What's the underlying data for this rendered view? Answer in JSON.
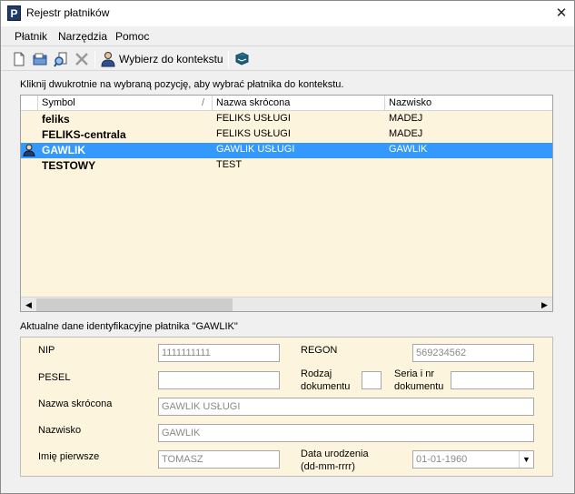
{
  "window": {
    "title": "Rejestr płatników",
    "app_icon_letter": "P",
    "close_glyph": "✕"
  },
  "menu": [
    "Płatnik",
    "Narzędzia",
    "Pomoc"
  ],
  "toolbar": {
    "icons": [
      "new-document-icon",
      "open-folder-icon",
      "find-icon",
      "delete-icon",
      "user-context-icon",
      "book-icon"
    ],
    "select_context_label": "Wybierz do kontekstu"
  },
  "hint": "Kliknij dwukrotnie na wybraną pozycję, aby wybrać płatnika do kontekstu.",
  "grid": {
    "columns": [
      "Symbol",
      "Nazwa skrócona",
      "Nazwisko"
    ],
    "sort_indicator": "/",
    "rows": [
      {
        "symbol": "feliks",
        "short_name": "FELIKS USŁUGI",
        "surname": "MADEJ",
        "selected": false
      },
      {
        "symbol": "FELIKS-centrala",
        "short_name": "FELIKS USŁUGI",
        "surname": "MADEJ",
        "selected": false
      },
      {
        "symbol": "GAWLIK",
        "short_name": "GAWLIK USŁUGI",
        "surname": "GAWLIK",
        "selected": true
      },
      {
        "symbol": "TESTOWY",
        "short_name": "TEST",
        "surname": "",
        "selected": false
      }
    ]
  },
  "details": {
    "title": "Aktualne dane identyfikacyjne płatnika \"GAWLIK\"",
    "nip": {
      "label": "NIP",
      "value": "1111111111"
    },
    "regon": {
      "label": "REGON",
      "value": "569234562"
    },
    "pesel": {
      "label": "PESEL",
      "value": ""
    },
    "doc_type": {
      "label_1": "Rodzaj",
      "label_2": "dokumentu",
      "value": ""
    },
    "doc_series": {
      "label_1": "Seria i nr",
      "label_2": "dokumentu",
      "value": ""
    },
    "short_name": {
      "label": "Nazwa skrócona",
      "value": "GAWLIK USŁUGI"
    },
    "surname": {
      "label": "Nazwisko",
      "value": "GAWLIK"
    },
    "first_name": {
      "label": "Imię pierwsze",
      "value": "TOMASZ"
    },
    "birth_date": {
      "label_1": "Data urodzenia",
      "label_2": "(dd-mm-rrrr)",
      "value": "01-01-1960"
    }
  }
}
